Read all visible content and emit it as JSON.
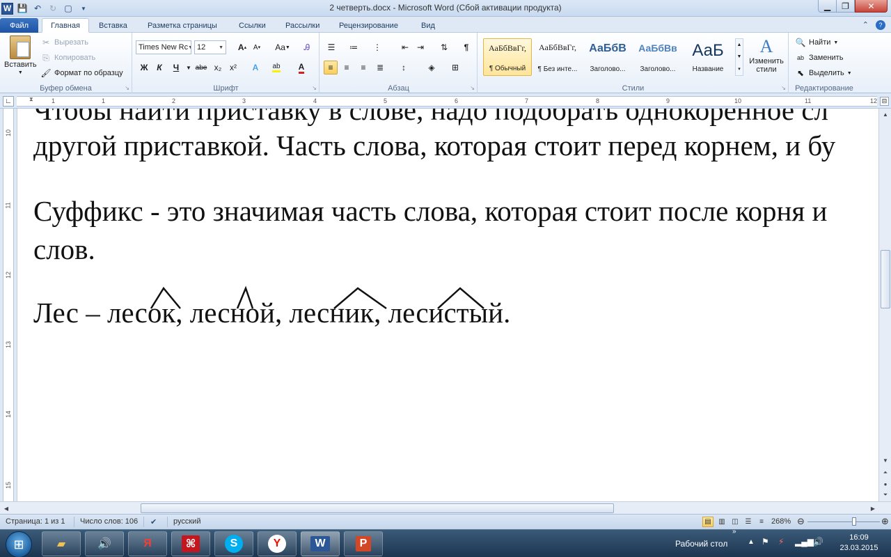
{
  "window": {
    "title": "2 четверть.docx - Microsoft Word (Сбой активации продукта)",
    "logo_letter": "W"
  },
  "tabs": [
    "Файл",
    "Главная",
    "Вставка",
    "Разметка страницы",
    "Ссылки",
    "Рассылки",
    "Рецензирование",
    "Вид"
  ],
  "ribbon": {
    "clipboard": {
      "paste": "Вставить",
      "cut": "Вырезать",
      "copy": "Копировать",
      "format_painter": "Формат по образцу",
      "label": "Буфер обмена"
    },
    "font": {
      "name": "Times New Rc",
      "size": "12",
      "label": "Шрифт",
      "grow": "A",
      "shrink": "A",
      "case": "Aa",
      "bold": "Ж",
      "italic": "К",
      "underline": "Ч",
      "strike": "abe",
      "sub": "x₂",
      "sup": "x²",
      "effects": "A",
      "color": "A"
    },
    "paragraph": {
      "label": "Абзац",
      "pilcrow": "¶"
    },
    "styles": {
      "label": "Стили",
      "items": [
        {
          "preview": "АаБбВвГг,",
          "name": "¶ Обычный"
        },
        {
          "preview": "АаБбВвГг,",
          "name": "¶ Без инте..."
        },
        {
          "preview": "АаБбВ",
          "name": "Заголово..."
        },
        {
          "preview": "АаБбВв",
          "name": "Заголово..."
        },
        {
          "preview": "АаБ",
          "name": "Название"
        }
      ],
      "change": "Изменить стили"
    },
    "editing": {
      "label": "Редактирование",
      "find": "Найти",
      "replace": "Заменить",
      "select": "Выделить"
    }
  },
  "ruler": {
    "h_numbers": [
      "1",
      "1",
      "2",
      "3",
      "4",
      "5",
      "6",
      "7",
      "8",
      "9",
      "10",
      "11",
      "12"
    ],
    "v_numbers": [
      "10",
      "11",
      "12",
      "13",
      "14",
      "15"
    ]
  },
  "document": {
    "line1_partial": "Чтобы найти приставку в слове, надо подобрать однокоренное сл",
    "line2": "другой приставкой. Часть слова, которая стоит перед корнем, и бу",
    "line3": "Суффикс - это значимая часть слова, которая стоит после корня и",
    "line4": "слов.",
    "line5": "Лес – лесок, лесной, лесник, лесистый."
  },
  "status": {
    "page": "Страница: 1 из 1",
    "words": "Число слов: 106",
    "language": "русский",
    "zoom": "268%"
  },
  "taskbar": {
    "desktop": "Рабочий стол",
    "time": "16:09",
    "date": "23.03.2015",
    "apps": [
      "explorer",
      "media-player",
      "yandex",
      "acrobat",
      "skype",
      "yandex-browser",
      "word",
      "powerpoint"
    ]
  }
}
